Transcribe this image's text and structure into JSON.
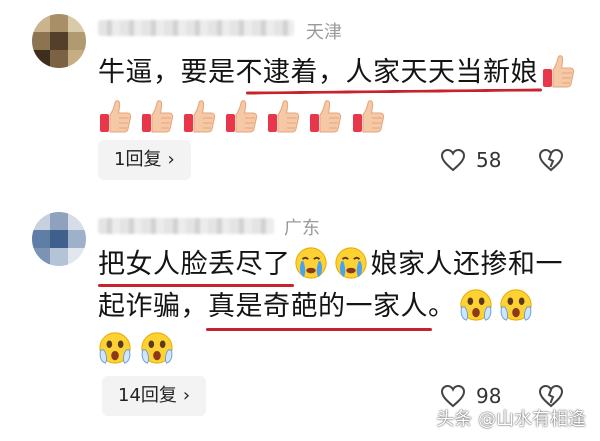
{
  "comments": [
    {
      "location": "天津",
      "text_lines": [
        "牛逼，要是不逮着，人家天天当新娘"
      ],
      "emoji": "thumbs-up",
      "emoji_count_row": 7,
      "replies_label": "1回复",
      "likes": "58"
    },
    {
      "location": "广东",
      "line1_a": "把女人脸丢尽了",
      "line1_b": "娘家人还掺和一",
      "line2": "起诈骗，真是奇葩的一家人。",
      "emoji": [
        "crying-face",
        "scared-face"
      ],
      "replies_label": "14回复",
      "likes": "98"
    }
  ],
  "watermark": "头条 @山水有相逢",
  "colors": {
    "underline": "#c8232c",
    "reply_bg": "#f3f3f3",
    "meta": "#9a9a9a"
  }
}
